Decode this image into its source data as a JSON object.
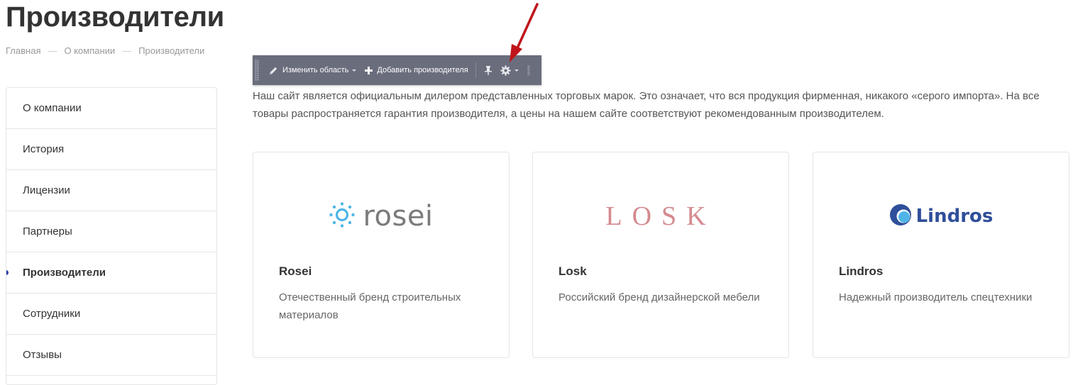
{
  "page": {
    "title": "Производители"
  },
  "breadcrumb": [
    {
      "label": "Главная"
    },
    {
      "label": "О компании"
    },
    {
      "label": "Производители"
    }
  ],
  "breadcrumb_separator": "—",
  "sidebar": {
    "items": [
      {
        "label": "О компании",
        "active": false
      },
      {
        "label": "История",
        "active": false
      },
      {
        "label": "Лицензии",
        "active": false
      },
      {
        "label": "Партнеры",
        "active": false
      },
      {
        "label": "Производители",
        "active": true
      },
      {
        "label": "Сотрудники",
        "active": false
      },
      {
        "label": "Отзывы",
        "active": false
      }
    ],
    "active_color": "#2b3ea6"
  },
  "toolbar": {
    "edit_area_label": "Изменить область",
    "add_manufacturer_label": "Добавить производителя",
    "background_color": "#6a6d7c",
    "icons": [
      "drag-handle-icon",
      "pencil-icon",
      "plus-icon",
      "pin-icon",
      "gear-icon",
      "resize-handle-icon"
    ]
  },
  "intro": {
    "text": "Наш сайт является официальным дилером представленных торговых марок. Это означает, что вся продукция фирменная, никакого «серого импорта». На все товары распространяется гарантия производителя, а цены на нашем сайте соответствуют рекомендованным производителем."
  },
  "manufacturers": [
    {
      "name": "Rosei",
      "logo_text": "rosei",
      "logo_color": "#4fb5e8",
      "description": "Отечественный бренд строительных материалов"
    },
    {
      "name": "Losk",
      "logo_text": "LOSK",
      "logo_color": "#d58a8f",
      "description": "Российский бренд дизайнерской мебели"
    },
    {
      "name": "Lindros",
      "logo_text": "Lindros",
      "logo_color": "#2f4f9a",
      "description": "Надежный производитель спецтехники"
    }
  ],
  "annotation": {
    "arrow_color": "#c0141a"
  }
}
